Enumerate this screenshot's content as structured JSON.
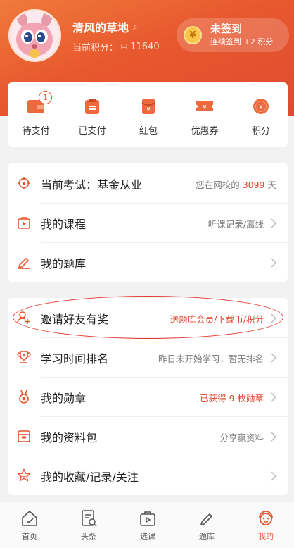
{
  "profile": {
    "username": "清风的草地",
    "points_label": "当前积分：",
    "points_value": "11640"
  },
  "checkin": {
    "coin_glyph": "¥",
    "title": "未签到",
    "subtitle": "连续签到 +2 积分"
  },
  "orders": {
    "items": [
      {
        "label": "待支付",
        "badge": "1"
      },
      {
        "label": "已支付"
      },
      {
        "label": "红包"
      },
      {
        "label": "优惠券"
      },
      {
        "label": "积分"
      }
    ]
  },
  "section1": {
    "exam": {
      "label": "当前考试：基金从业",
      "right_prefix": "您在网校的 ",
      "days": "3099",
      "right_suffix": " 天"
    },
    "courses": {
      "label": "我的课程",
      "right": "听课记录/离线"
    },
    "question_bank": {
      "label": "我的题库"
    }
  },
  "section2": {
    "invite": {
      "label": "邀请好友有奖",
      "right": "送题库会员/下载币/积分"
    },
    "ranking": {
      "label": "学习时间排名",
      "right": "昨日未开始学习，暂无排名"
    },
    "medals": {
      "label": "我的勋章",
      "right": "已获得 9 枚勋章"
    },
    "materials": {
      "label": "我的资料包",
      "right": "分享赢资料"
    },
    "favorites": {
      "label": "我的收藏/记录/关注"
    }
  },
  "tabbar": {
    "items": [
      {
        "label": "首页"
      },
      {
        "label": "头条"
      },
      {
        "label": "选课"
      },
      {
        "label": "题库"
      },
      {
        "label": "我的"
      }
    ]
  },
  "colors": {
    "accent": "#e8542e",
    "accent_text_red": "#e0442c",
    "checkin_coin": "#f7c64a"
  }
}
